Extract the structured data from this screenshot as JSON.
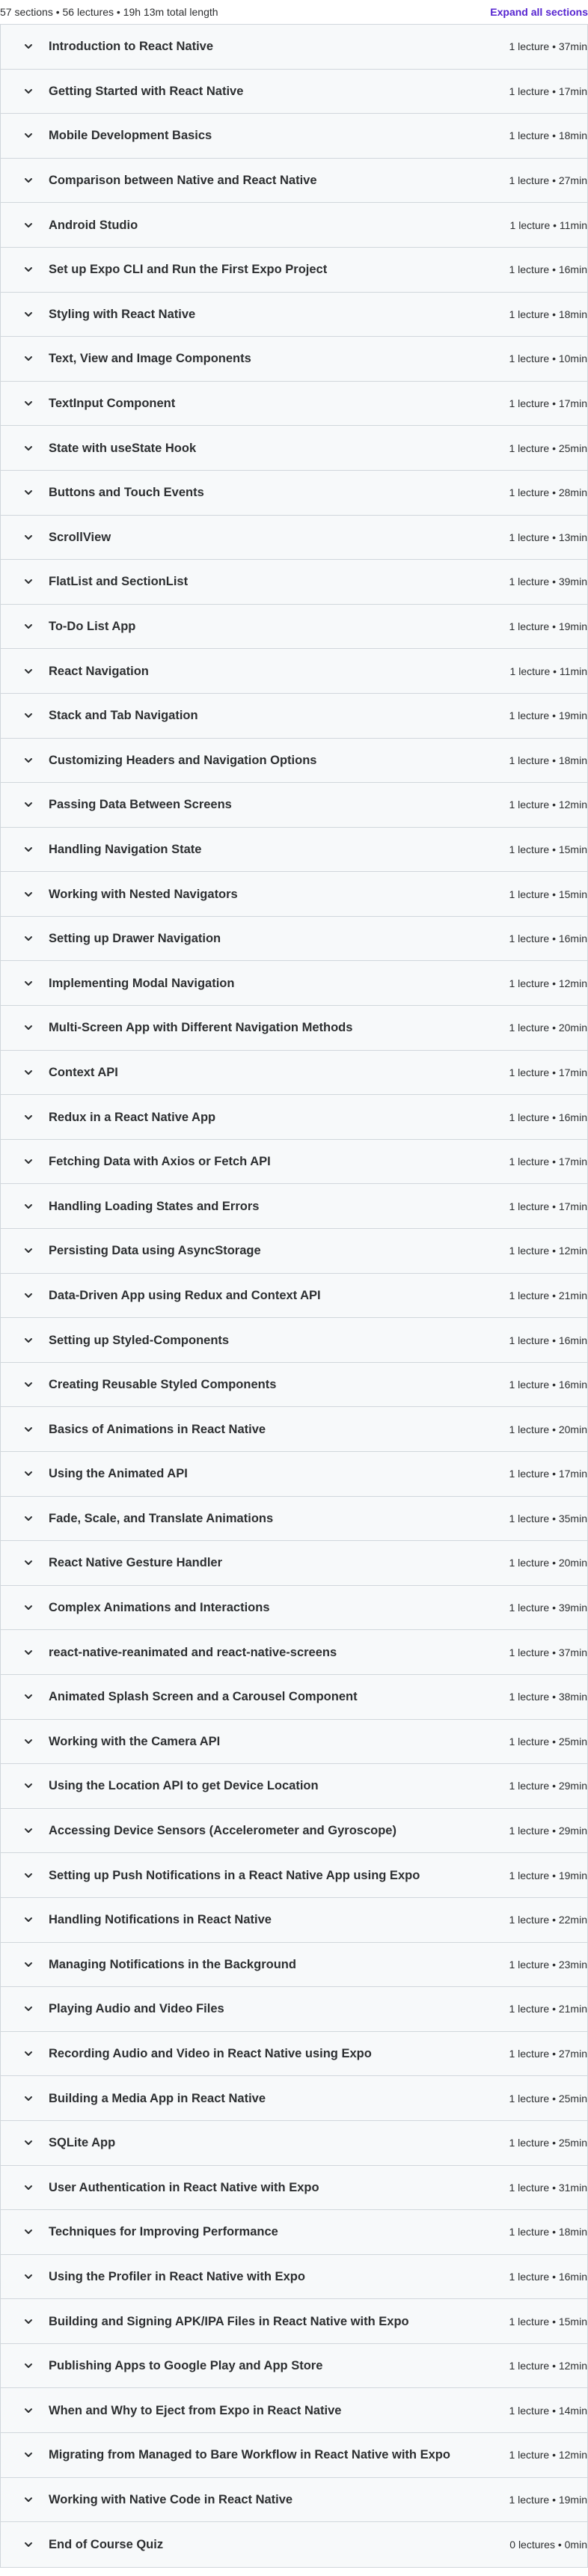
{
  "header": {
    "summary": "57 sections • 56 lectures • 19h 13m total length",
    "expand_label": "Expand all sections"
  },
  "sections": [
    {
      "title": "Introduction to React Native",
      "meta": "1 lecture • 37min"
    },
    {
      "title": "Getting Started with React Native",
      "meta": "1 lecture • 17min"
    },
    {
      "title": "Mobile Development Basics",
      "meta": "1 lecture • 18min"
    },
    {
      "title": "Comparison between Native and React Native",
      "meta": "1 lecture • 27min"
    },
    {
      "title": "Android Studio",
      "meta": "1 lecture • 11min"
    },
    {
      "title": "Set up Expo CLI and Run the First Expo Project",
      "meta": "1 lecture • 16min"
    },
    {
      "title": "Styling with React Native",
      "meta": "1 lecture • 18min"
    },
    {
      "title": "Text, View and Image Components",
      "meta": "1 lecture • 10min"
    },
    {
      "title": "TextInput Component",
      "meta": "1 lecture • 17min"
    },
    {
      "title": "State with useState Hook",
      "meta": "1 lecture • 25min"
    },
    {
      "title": "Buttons and Touch Events",
      "meta": "1 lecture • 28min"
    },
    {
      "title": "ScrollView",
      "meta": "1 lecture • 13min"
    },
    {
      "title": "FlatList and SectionList",
      "meta": "1 lecture • 39min"
    },
    {
      "title": "To-Do List App",
      "meta": "1 lecture • 19min"
    },
    {
      "title": "React Navigation",
      "meta": "1 lecture • 11min"
    },
    {
      "title": "Stack and Tab Navigation",
      "meta": "1 lecture • 19min"
    },
    {
      "title": "Customizing Headers and Navigation Options",
      "meta": "1 lecture • 18min"
    },
    {
      "title": "Passing Data Between Screens",
      "meta": "1 lecture • 12min"
    },
    {
      "title": "Handling Navigation State",
      "meta": "1 lecture • 15min"
    },
    {
      "title": "Working with Nested Navigators",
      "meta": "1 lecture • 15min"
    },
    {
      "title": "Setting up Drawer Navigation",
      "meta": "1 lecture • 16min"
    },
    {
      "title": "Implementing Modal Navigation",
      "meta": "1 lecture • 12min"
    },
    {
      "title": "Multi-Screen App with Different Navigation Methods",
      "meta": "1 lecture • 20min"
    },
    {
      "title": "Context API",
      "meta": "1 lecture • 17min"
    },
    {
      "title": "Redux in a React Native App",
      "meta": "1 lecture • 16min"
    },
    {
      "title": "Fetching Data with Axios or Fetch API",
      "meta": "1 lecture • 17min"
    },
    {
      "title": "Handling Loading States and Errors",
      "meta": "1 lecture • 17min"
    },
    {
      "title": "Persisting Data using AsyncStorage",
      "meta": "1 lecture • 12min"
    },
    {
      "title": "Data-Driven App using Redux and Context API",
      "meta": "1 lecture • 21min"
    },
    {
      "title": "Setting up Styled-Components",
      "meta": "1 lecture • 16min"
    },
    {
      "title": "Creating Reusable Styled Components",
      "meta": "1 lecture • 16min"
    },
    {
      "title": "Basics of Animations in React Native",
      "meta": "1 lecture • 20min"
    },
    {
      "title": "Using the Animated API",
      "meta": "1 lecture • 17min"
    },
    {
      "title": "Fade, Scale, and Translate Animations",
      "meta": "1 lecture • 35min"
    },
    {
      "title": "React Native Gesture Handler",
      "meta": "1 lecture • 20min"
    },
    {
      "title": "Complex Animations and Interactions",
      "meta": "1 lecture • 39min"
    },
    {
      "title": "react-native-reanimated and react-native-screens",
      "meta": "1 lecture • 37min"
    },
    {
      "title": "Animated Splash Screen and a Carousel Component",
      "meta": "1 lecture • 38min"
    },
    {
      "title": "Working with the Camera API",
      "meta": "1 lecture • 25min"
    },
    {
      "title": "Using the Location API to get Device Location",
      "meta": "1 lecture • 29min"
    },
    {
      "title": "Accessing Device Sensors (Accelerometer and Gyroscope)",
      "meta": "1 lecture • 29min"
    },
    {
      "title": "Setting up Push Notifications in a React Native App using Expo",
      "meta": "1 lecture • 19min"
    },
    {
      "title": "Handling Notifications in React Native",
      "meta": "1 lecture • 22min"
    },
    {
      "title": "Managing Notifications in the Background",
      "meta": "1 lecture • 23min"
    },
    {
      "title": "Playing Audio and Video Files",
      "meta": "1 lecture • 21min"
    },
    {
      "title": "Recording Audio and Video in React Native using Expo",
      "meta": "1 lecture • 27min"
    },
    {
      "title": "Building a Media App in React Native",
      "meta": "1 lecture • 25min"
    },
    {
      "title": "SQLite App",
      "meta": "1 lecture • 25min"
    },
    {
      "title": "User Authentication in React Native with Expo",
      "meta": "1 lecture • 31min"
    },
    {
      "title": "Techniques for Improving Performance",
      "meta": "1 lecture • 18min"
    },
    {
      "title": "Using the Profiler in React Native with Expo",
      "meta": "1 lecture • 16min"
    },
    {
      "title": "Building and Signing APK/IPA Files in React Native with Expo",
      "meta": "1 lecture • 15min"
    },
    {
      "title": "Publishing Apps to Google Play and App Store",
      "meta": "1 lecture • 12min"
    },
    {
      "title": "When and Why to Eject from Expo in React Native",
      "meta": "1 lecture • 14min"
    },
    {
      "title": "Migrating from Managed to Bare Workflow in React Native with Expo",
      "meta": "1 lecture • 12min"
    },
    {
      "title": "Working with Native Code in React Native",
      "meta": "1 lecture • 19min"
    },
    {
      "title": "End of Course Quiz",
      "meta": "0 lectures • 0min"
    }
  ]
}
